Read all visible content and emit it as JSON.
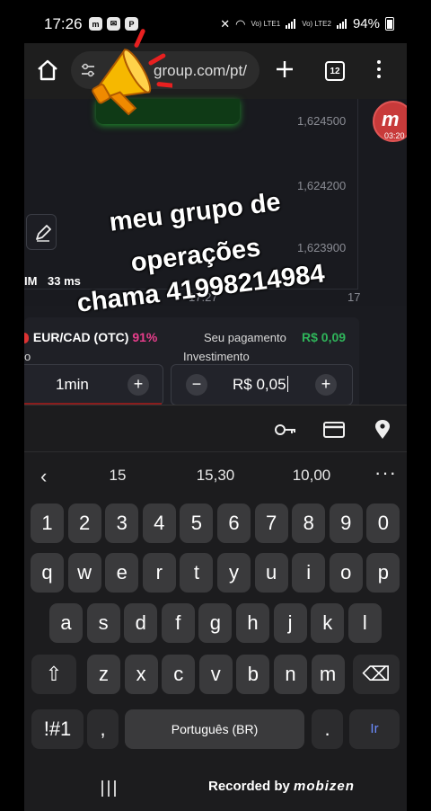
{
  "status_bar": {
    "time": "17:26",
    "left_icons": [
      "m-app-icon",
      "messages-icon",
      "paypal-icon"
    ],
    "net1": "Vo) LTE1",
    "net2": "Vo) LTE2",
    "battery": "94%"
  },
  "browser": {
    "url": "group.com/pt/",
    "tab_count": "12"
  },
  "chart": {
    "y_ticks": [
      "1,624500",
      "1,624200",
      "1,623900"
    ],
    "x_ticks": [
      "17:27",
      "17"
    ]
  },
  "ping": {
    "prefix": "IM",
    "value": "33 ms"
  },
  "bubble": {
    "letter": "m",
    "time": "03:20"
  },
  "trade": {
    "asset": "EUR/CAD (OTC)",
    "asset_pct": "91%",
    "payment_label": "Seu pagamento",
    "payment_value": "R$ 0,09",
    "time_label": "o",
    "time_value": "1min",
    "investment_label": "Investimento",
    "investment_value": "R$ 0,05",
    "plus": "+",
    "minus": "−"
  },
  "keyboard": {
    "suggestions": [
      "15",
      "15,30",
      "10,00"
    ],
    "row_numbers": [
      "1",
      "2",
      "3",
      "4",
      "5",
      "6",
      "7",
      "8",
      "9",
      "0"
    ],
    "row1": [
      "q",
      "w",
      "e",
      "r",
      "t",
      "y",
      "u",
      "i",
      "o",
      "p"
    ],
    "row2": [
      "a",
      "s",
      "d",
      "f",
      "g",
      "h",
      "j",
      "k",
      "l"
    ],
    "row3": [
      "z",
      "x",
      "c",
      "v",
      "b",
      "n",
      "m"
    ],
    "symbols": "!#1",
    "comma": ",",
    "space": "Português (BR)",
    "period": ".",
    "enter": "Ir",
    "shift": "⇧",
    "backspace": "⌫"
  },
  "overlay": {
    "line1": "meu grupo de",
    "line2": "operações",
    "line3": "chama 41998214984"
  },
  "recorder": {
    "text": "Recorded by",
    "brand": "mobizen"
  },
  "colors": {
    "payment_green": "#2fb45a",
    "pct_pink": "#e83e8c",
    "enter_blue": "#6c8cff"
  }
}
